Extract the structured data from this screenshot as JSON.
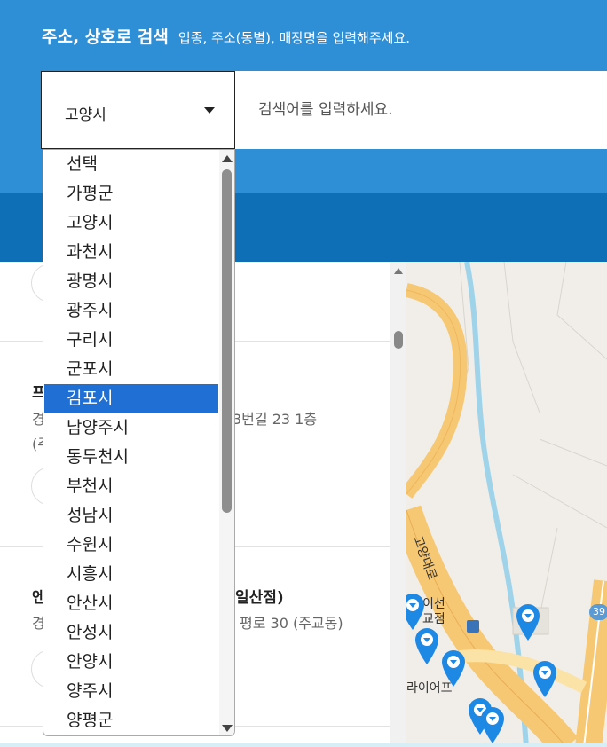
{
  "header": {
    "title": "주소, 상호로 검색",
    "subtitle": "업종, 주소(동별), 매장명을 입력해주세요.",
    "city_select_value": "고양시",
    "search_placeholder": "검색어를 입력하세요."
  },
  "city_dropdown": {
    "selected": "김포시",
    "options": [
      "선택",
      "가평군",
      "고양시",
      "과천시",
      "광명시",
      "광주시",
      "구리시",
      "군포시",
      "김포시",
      "남양주시",
      "동두천시",
      "부천시",
      "성남시",
      "수원시",
      "시흥시",
      "안산시",
      "안성시",
      "안양시",
      "양주시",
      "양평군"
    ]
  },
  "stores": [
    {
      "name_partial": "프",
      "address_partial": "경",
      "address_tail": "3번길 23 1층",
      "extra_partial": "(주"
    },
    {
      "name_partial": "엔",
      "name_tail": "일산점)",
      "address_partial": "경",
      "address_tail": "평로 30 (주교동)"
    }
  ],
  "map": {
    "labels": [
      "고양대로",
      "이선",
      "교점",
      "라이어프",
      "39"
    ],
    "pin_color": "#1e88e5",
    "road_color": "#f7c873",
    "river_color": "#9fd3ea"
  }
}
